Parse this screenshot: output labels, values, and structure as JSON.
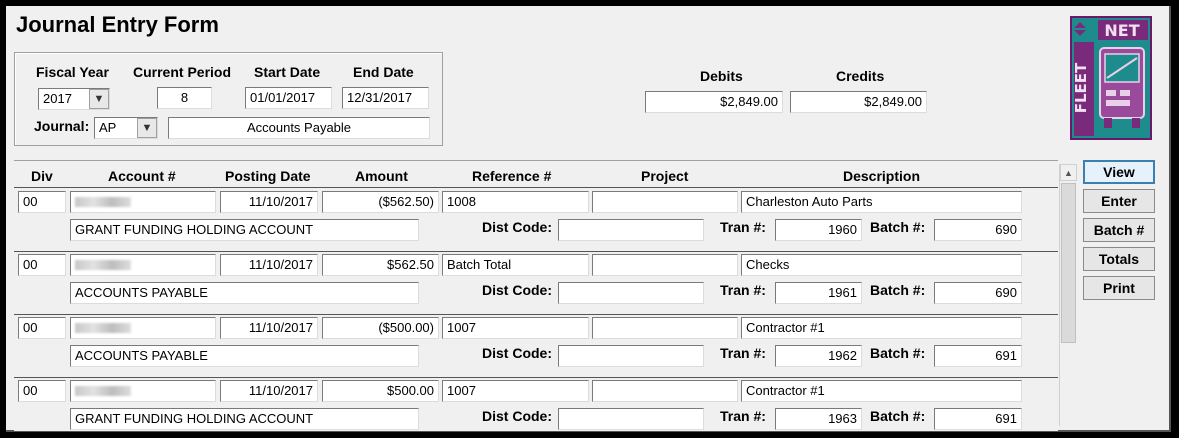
{
  "title": "Journal Entry Form",
  "header": {
    "fiscal_year_label": "Fiscal Year",
    "fiscal_year": "2017",
    "current_period_label": "Current Period",
    "current_period": "8",
    "start_date_label": "Start Date",
    "start_date": "01/01/2017",
    "end_date_label": "End Date",
    "end_date": "12/31/2017",
    "journal_label": "Journal:",
    "journal_code": "AP",
    "journal_name": "Accounts Payable",
    "debits_label": "Debits",
    "debits": "$2,849.00",
    "credits_label": "Credits",
    "credits": "$2,849.00"
  },
  "logo": {
    "net": "NET",
    "fleet": "FLEET"
  },
  "columns": {
    "div": "Div",
    "account": "Account #",
    "posting_date": "Posting Date",
    "amount": "Amount",
    "reference": "Reference #",
    "project": "Project",
    "description": "Description"
  },
  "labels": {
    "dist_code": "Dist Code:",
    "tran": "Tran #:",
    "batch": "Batch #:"
  },
  "entries": [
    {
      "div": "00",
      "posting_date": "11/10/2017",
      "amount": "($562.50)",
      "reference": "1008",
      "project": "",
      "description": "Charleston Auto Parts",
      "account_name": "GRANT FUNDING HOLDING ACCOUNT",
      "dist_code": "",
      "tran": "1960",
      "batch": "690"
    },
    {
      "div": "00",
      "posting_date": "11/10/2017",
      "amount": "$562.50",
      "reference": "Batch Total",
      "project": "",
      "description": "Checks",
      "account_name": "ACCOUNTS PAYABLE",
      "dist_code": "",
      "tran": "1961",
      "batch": "690"
    },
    {
      "div": "00",
      "posting_date": "11/10/2017",
      "amount": "($500.00)",
      "reference": "1007",
      "project": "",
      "description": "Contractor #1",
      "account_name": "ACCOUNTS PAYABLE",
      "dist_code": "",
      "tran": "1962",
      "batch": "691"
    },
    {
      "div": "00",
      "posting_date": "11/10/2017",
      "amount": "$500.00",
      "reference": "1007",
      "project": "",
      "description": "Contractor #1",
      "account_name": "GRANT FUNDING HOLDING ACCOUNT",
      "dist_code": "",
      "tran": "1963",
      "batch": "691"
    }
  ],
  "side_buttons": [
    "View",
    "Enter",
    "Batch #",
    "Totals",
    "Print"
  ]
}
